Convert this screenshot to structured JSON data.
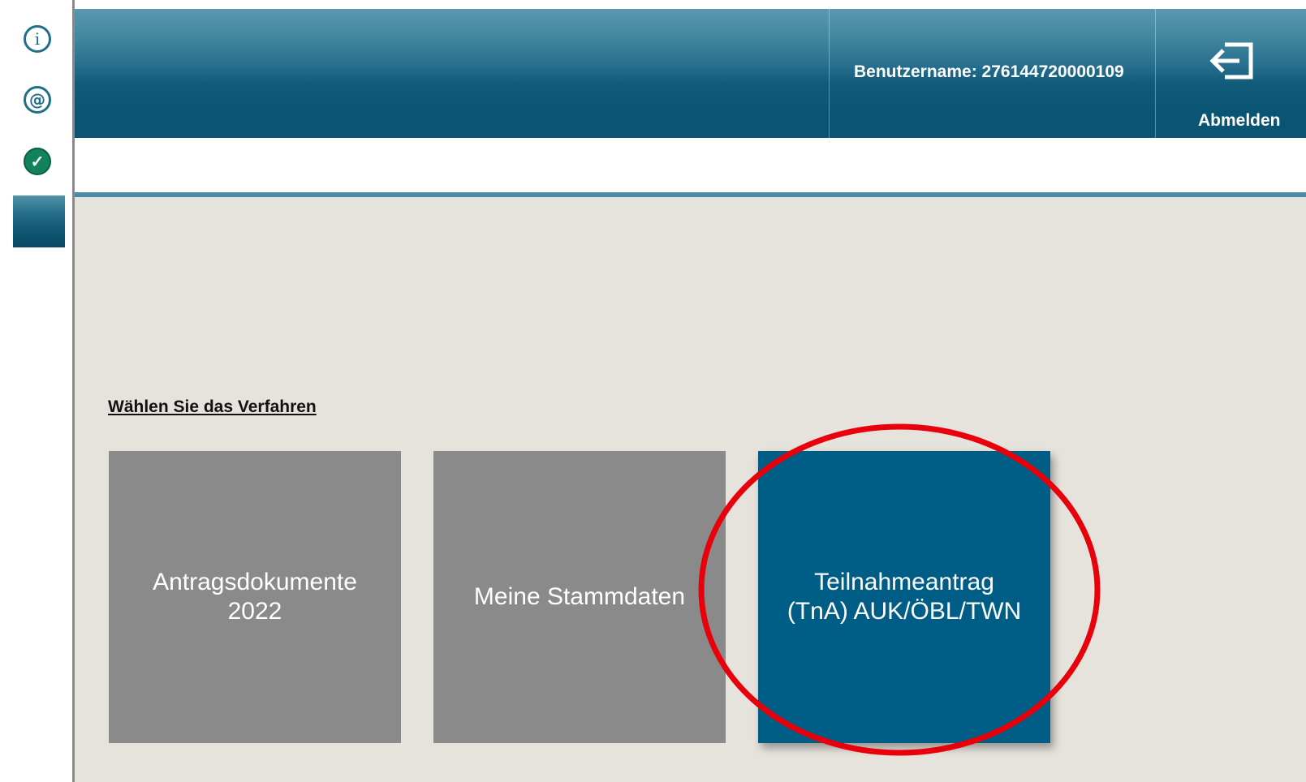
{
  "header": {
    "username": "Benutzername: 276144720000109",
    "logout_label": "Abmelden"
  },
  "sidebar": {
    "icons": [
      {
        "name": "info-icon",
        "glyph": "i"
      },
      {
        "name": "at-icon",
        "glyph": "@"
      },
      {
        "name": "check-icon",
        "glyph": "✓"
      }
    ]
  },
  "main": {
    "heading": "Wählen Sie das Verfahren",
    "tiles": [
      {
        "label": "Antragsdokumente\n2022",
        "color": "#8a8a8a"
      },
      {
        "label": "Meine Stammdaten",
        "color": "#8a8a8a"
      },
      {
        "label": "Teilnahmeantrag\n(TnA) AUK/ÖBL/TWN",
        "color": "#005e86"
      }
    ]
  },
  "annotation": {
    "highlight_color": "#e8000b"
  }
}
